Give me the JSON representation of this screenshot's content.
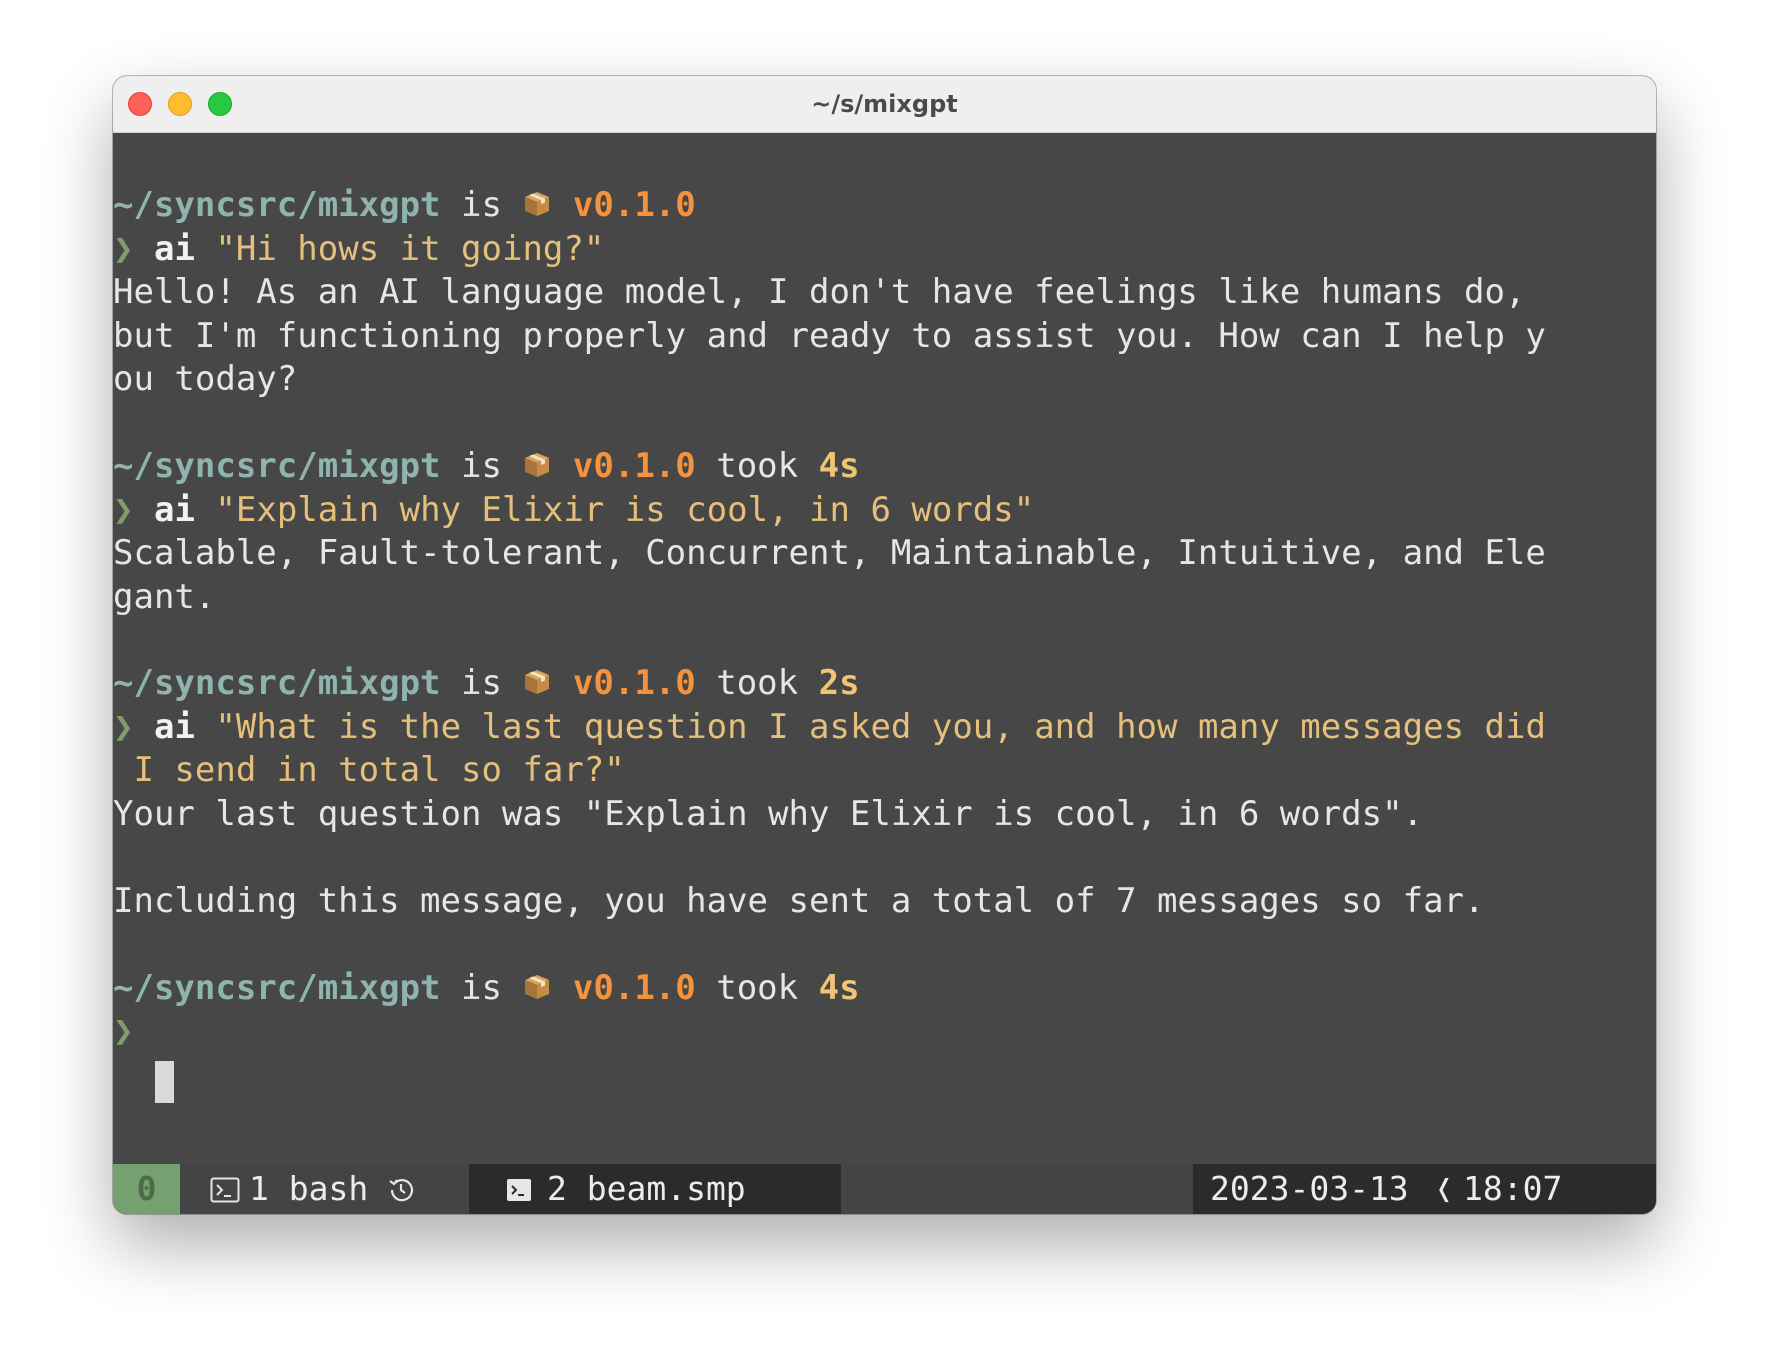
{
  "window": {
    "title": "~/s/mixgpt"
  },
  "prompt": {
    "path": "~/syncsrc/mixgpt",
    "is_word": "is",
    "package_icon": "package-icon",
    "version": "v0.1.0",
    "took_word": "took",
    "chevron": "❯"
  },
  "blocks": [
    {
      "took": "",
      "command": "ai",
      "arg_lines": [
        "\"Hi hows it going?\""
      ],
      "output_lines": [
        "Hello! As an AI language model, I don't have feelings like humans do,",
        "but I'm functioning properly and ready to assist you. How can I help y",
        "ou today?"
      ]
    },
    {
      "took": "4s",
      "command": "ai",
      "arg_lines": [
        "\"Explain why Elixir is cool, in 6 words\""
      ],
      "output_lines": [
        "Scalable, Fault-tolerant, Concurrent, Maintainable, Intuitive, and Ele",
        "gant."
      ]
    },
    {
      "took": "2s",
      "command": "ai",
      "arg_lines": [
        "\"What is the last question I asked you, and how many messages did",
        " I send in total so far?\""
      ],
      "output_lines": [
        "Your last question was \"Explain why Elixir is cool, in 6 words\".",
        "",
        "Including this message, you have sent a total of 7 messages so far."
      ]
    },
    {
      "took": "4s"
    }
  ],
  "statusbar": {
    "session": "0",
    "windows": [
      {
        "icon": "terminal-icon",
        "label": "1 bash",
        "extra_icon": "history-icon"
      },
      {
        "icon": "terminal-icon",
        "label": "2 beam.smp"
      }
    ],
    "date": "2023-03-13",
    "separator": "❬",
    "time": "18:07"
  },
  "colors": {
    "background": "#474747",
    "path": "#8fb3ad",
    "version": "#f5923e",
    "string": "#e5c07b",
    "session": "#75a070"
  }
}
